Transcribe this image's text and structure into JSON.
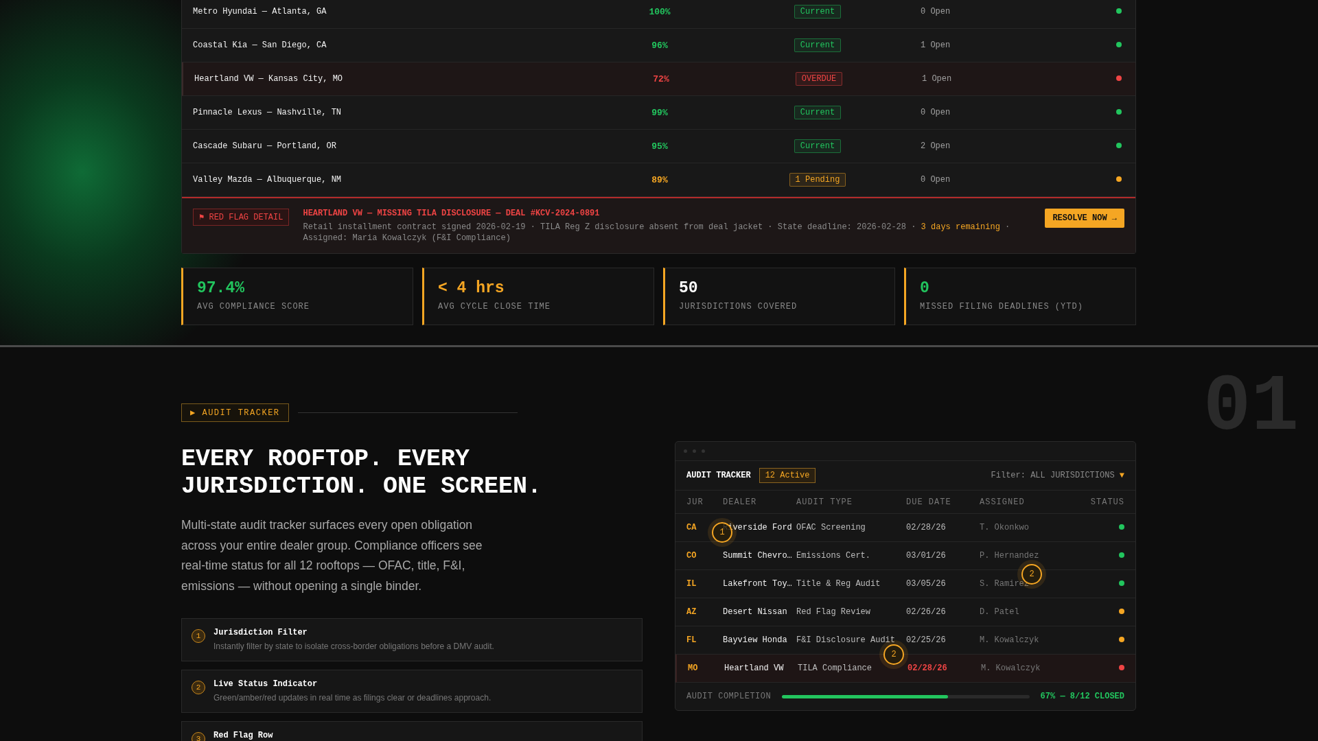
{
  "dealer_table": {
    "rows": [
      {
        "dealer": "Metro Hyundai — Atlanta, GA",
        "score": "100%",
        "badge": "Current",
        "open": "0 Open",
        "color": "#22c55e",
        "overdue": false
      },
      {
        "dealer": "Coastal Kia — San Diego, CA",
        "score": "96%",
        "badge": "Current",
        "open": "1 Open",
        "color": "#22c55e",
        "overdue": false
      },
      {
        "dealer": "Heartland VW — Kansas City, MO",
        "score": "72%",
        "badge": "OVERDUE",
        "open": "1 Open",
        "color": "#ef4444",
        "overdue": true
      },
      {
        "dealer": "Pinnacle Lexus — Nashville, TN",
        "score": "99%",
        "badge": "Current",
        "open": "0 Open",
        "color": "#22c55e",
        "overdue": false
      },
      {
        "dealer": "Cascade Subaru — Portland, OR",
        "score": "95%",
        "badge": "Current",
        "open": "2 Open",
        "color": "#22c55e",
        "overdue": false
      },
      {
        "dealer": "Valley Mazda — Albuquerque, NM",
        "score": "89%",
        "badge": "1 Pending",
        "open": "0 Open",
        "color": "#f5a623",
        "overdue": false
      }
    ]
  },
  "red_flag": {
    "tag": "⚑ RED FLAG DETAIL",
    "title": "HEARTLAND VW — MISSING TILA DISCLOSURE — DEAL #KCV-2024-0891",
    "description": [
      {
        "text": "Retail installment contract signed 2026-02-19 · TILA Reg Z disclosure absent from deal jacket · State deadline: 2026-02-28 · ",
        "highlight": false
      },
      {
        "text": "3 days remaining",
        "highlight": true
      },
      {
        "text": " · Assigned: Maria Kowalczyk (F&I Compliance)",
        "highlight": false
      }
    ],
    "button": "RESOLVE NOW →"
  },
  "stats": [
    {
      "value": "97.4%",
      "label": "AVG COMPLIANCE SCORE",
      "color": "#22c55e"
    },
    {
      "value": "< 4 hrs",
      "label": "AVG CYCLE CLOSE TIME",
      "color": "#f5a623"
    },
    {
      "value": "50",
      "label": "JURISDICTIONS COVERED",
      "color": "#ffffff"
    },
    {
      "value": "0",
      "label": "MISSED FILING DEADLINES (YTD)",
      "color": "#22c55e"
    }
  ],
  "section": {
    "number": "01",
    "tag": "▶ AUDIT TRACKER",
    "heading": "EVERY ROOFTOP. EVERY JURISDICTION. ONE SCREEN.",
    "body": "Multi-state audit tracker surfaces every open obligation across your entire dealer group. Compliance officers see real-time status for all 12 rooftops — OFAC, title, F&I, emissions — without opening a single binder.",
    "features": [
      {
        "number": "1",
        "title": "Jurisdiction Filter",
        "text": "Instantly filter by state to isolate cross-border obligations before a DMV audit."
      },
      {
        "number": "2",
        "title": "Live Status Indicator",
        "text": "Green/amber/red updates in real time as filings clear or deadlines approach."
      },
      {
        "number": "3",
        "title": "Red Flag Row"
      }
    ]
  },
  "tracker": {
    "title": "AUDIT TRACKER",
    "active_badge": "12 Active",
    "filter": "Filter: ALL JURISDICTIONS",
    "filter_caret": "▼",
    "columns": [
      "JUR",
      "DEALER",
      "AUDIT TYPE",
      "DUE DATE",
      "ASSIGNED",
      "STATUS"
    ],
    "rows": [
      {
        "jur": "CA",
        "dealer": "Riverside Ford",
        "audit_type": "OFAC Screening",
        "due": "02/28/26",
        "assigned": "T. Okonkwo",
        "color": "#22c55e",
        "overdue": false
      },
      {
        "jur": "CO",
        "dealer": "Summit Chevro…",
        "audit_type": "Emissions Cert.",
        "due": "03/01/26",
        "assigned": "P. Hernandez",
        "color": "#22c55e",
        "overdue": false
      },
      {
        "jur": "IL",
        "dealer": "Lakefront Toy…",
        "audit_type": "Title & Reg Audit",
        "due": "03/05/26",
        "assigned": "S. Ramirez",
        "color": "#22c55e",
        "overdue": false
      },
      {
        "jur": "AZ",
        "dealer": "Desert Nissan",
        "audit_type": "Red Flag Review",
        "due": "02/26/26",
        "assigned": "D. Patel",
        "color": "#f5a623",
        "overdue": false
      },
      {
        "jur": "FL",
        "dealer": "Bayview Honda",
        "audit_type": "F&I Disclosure Audit",
        "due": "02/25/26",
        "assigned": "M. Kowalczyk",
        "color": "#f5a623",
        "overdue": false
      },
      {
        "jur": "MO",
        "dealer": "Heartland VW",
        "audit_type": "TILA Compliance",
        "due": "02/28/26",
        "assigned": "M. Kowalczyk",
        "color": "#ef4444",
        "overdue": true
      }
    ],
    "markers": [
      "1",
      "2",
      "2"
    ],
    "completion_label": "AUDIT COMPLETION",
    "level": 0.67,
    "completion_text": "67% — 8/12 CLOSED"
  }
}
